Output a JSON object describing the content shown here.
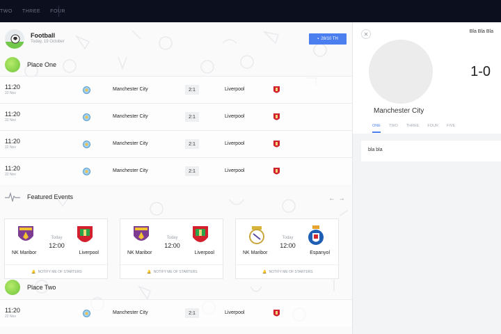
{
  "topnav": {
    "tabs": [
      "TWO",
      "THREE",
      "FOUR"
    ]
  },
  "header": {
    "title": "Football",
    "subtitle": "Today, 19 October",
    "date_button": "28/10 TH"
  },
  "places": [
    {
      "title": "Place One"
    },
    {
      "title": "Place Two"
    }
  ],
  "matches_place_one": [
    {
      "time": "11:20",
      "date": "22 Nov",
      "home": "Manchester City",
      "score": "2:1",
      "away": "Liverpool"
    },
    {
      "time": "11:20",
      "date": "22 Nov",
      "home": "Manchester City",
      "score": "2:1",
      "away": "Liverpool"
    },
    {
      "time": "11:20",
      "date": "22 Nov",
      "home": "Manchester City",
      "score": "2:1",
      "away": "Liverpool"
    },
    {
      "time": "11:20",
      "date": "22 Nov",
      "home": "Manchester City",
      "score": "2:1",
      "away": "Liverpool"
    }
  ],
  "matches_place_two": [
    {
      "time": "11:20",
      "date": "22 Nov",
      "home": "Manchester City",
      "score": "2:1",
      "away": "Liverpool"
    }
  ],
  "featured": {
    "title": "Featured Events",
    "cards": [
      {
        "home": "NK Maribor",
        "away": "Liverpool",
        "day": "Today",
        "time": "12:00",
        "notify": "NOTIFY ME OF STARTERS"
      },
      {
        "home": "NK Maribor",
        "away": "Liverpool",
        "day": "Today",
        "time": "12:00",
        "notify": "NOTIFY ME OF STARTERS"
      },
      {
        "home": "NK Maribor",
        "away": "Espanyol",
        "day": "Today",
        "time": "12:00",
        "notify": "NOTIFY ME OF STARTERS"
      }
    ]
  },
  "detail": {
    "label": "Bla Bla Bla",
    "score": "1-0",
    "team": "Manchester City",
    "tabs": [
      "ONE",
      "TWO",
      "THREE",
      "FOUR",
      "FIVE"
    ],
    "content": "bla bla"
  },
  "colors": {
    "accent": "#4b7ff0",
    "nav_bg": "#0b0f1e",
    "ball_green": "#7dd04a"
  },
  "icons": {
    "close": "close-icon",
    "arrow_left": "arrow-left-icon",
    "arrow_right": "arrow-right-icon",
    "bell": "bell-icon",
    "calendar": "calendar-icon",
    "pulse": "pulse-icon"
  }
}
